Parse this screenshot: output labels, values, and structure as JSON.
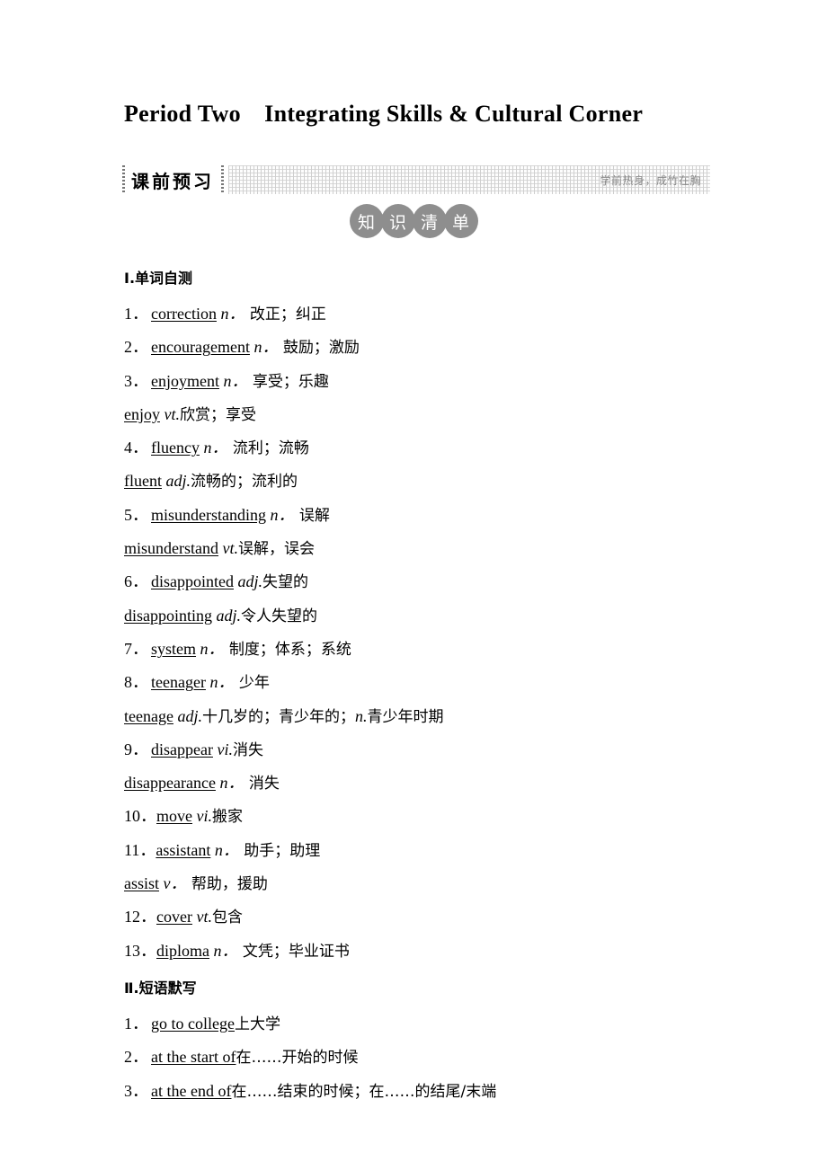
{
  "page": {
    "title": "Period Two　Integrating Skills & Cultural Corner"
  },
  "banner": {
    "label": "课前预习",
    "motto": "学前热身，成竹在胸"
  },
  "badge": {
    "chars": [
      "知",
      "识",
      "清",
      "单"
    ]
  },
  "sections": [
    {
      "heading": "Ⅰ.单词自测",
      "entries": [
        {
          "num": "1．",
          "word": "correction",
          "pos": "n．",
          "cn": " 改正；纠正"
        },
        {
          "num": "2．",
          "word": "encouragement",
          "pos": "n．",
          "cn": " 鼓励；激励"
        },
        {
          "num": "3．",
          "word": "enjoyment",
          "pos": "n．",
          "cn": " 享受；乐趣"
        },
        {
          "num": "",
          "word": "enjoy",
          "pos": "vt.",
          "cn": "欣赏；享受"
        },
        {
          "num": "4．",
          "word": "fluency",
          "pos": "n．",
          "cn": " 流利；流畅"
        },
        {
          "num": "",
          "word": "fluent",
          "pos": "adj.",
          "cn": "流畅的；流利的"
        },
        {
          "num": "5．",
          "word": "misunderstanding",
          "pos": "n．",
          "cn": " 误解"
        },
        {
          "num": "",
          "word": "misunderstand",
          "pos": "vt.",
          "cn": "误解，误会"
        },
        {
          "num": "6．",
          "word": "disappointed",
          "pos": "adj.",
          "cn": "失望的"
        },
        {
          "num": "",
          "word": "disappointing",
          "pos": "adj.",
          "cn": "令人失望的"
        },
        {
          "num": "7．",
          "word": "system",
          "pos": "n．",
          "cn": " 制度；体系；系统"
        },
        {
          "num": "8．",
          "word": "teenager",
          "pos": "n．",
          "cn": " 少年"
        },
        {
          "num": "",
          "word": "teenage",
          "pos": "adj.",
          "cn": "十几岁的；青少年的；",
          "pos2": "n.",
          "cn2": "青少年时期"
        },
        {
          "num": "9．",
          "word": "disappear",
          "pos": "vi.",
          "cn": "消失"
        },
        {
          "num": "",
          "word": "disappearance",
          "pos": "n．",
          "cn": " 消失"
        },
        {
          "num": "10．",
          "word": "move",
          "pos": "vi.",
          "cn": "搬家"
        },
        {
          "num": "11．",
          "word": "assistant",
          "pos": "n．",
          "cn": " 助手；助理"
        },
        {
          "num": "",
          "word": "assist",
          "pos": "v．",
          "cn": " 帮助，援助"
        },
        {
          "num": "12．",
          "word": "cover",
          "pos": "vt.",
          "cn": "包含"
        },
        {
          "num": "13．",
          "word": "diploma",
          "pos": "n．",
          "cn": " 文凭；毕业证书"
        }
      ]
    },
    {
      "heading": "Ⅱ.短语默写",
      "entries": [
        {
          "num": "1．",
          "word": "go to college",
          "pos": "",
          "cn": "上大学"
        },
        {
          "num": "2．",
          "word": "at the start of",
          "pos": "",
          "cn": "在……开始的时候"
        },
        {
          "num": "3．",
          "word": "at the end of",
          "pos": "",
          "cn": "在……结束的时候；在……的结尾/末端"
        }
      ]
    }
  ]
}
